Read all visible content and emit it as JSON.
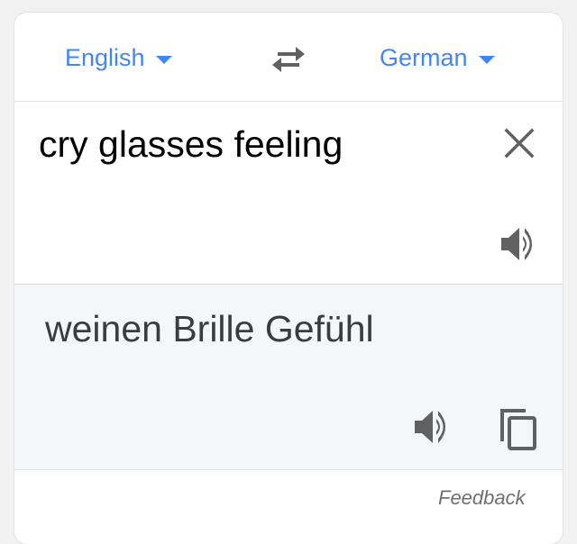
{
  "languages": {
    "source": "English",
    "target": "German"
  },
  "input": {
    "text": "cry glasses feeling"
  },
  "output": {
    "text": "weinen Brille Gefühl"
  },
  "footer": {
    "feedback_label": "Feedback"
  },
  "icons": {
    "swap": "swap-arrows-icon",
    "clear": "close-icon",
    "speaker": "speaker-icon",
    "copy": "copy-icon"
  },
  "colors": {
    "accent": "#4285f4",
    "icon": "#616161",
    "output_bg": "#f5f6f8"
  }
}
